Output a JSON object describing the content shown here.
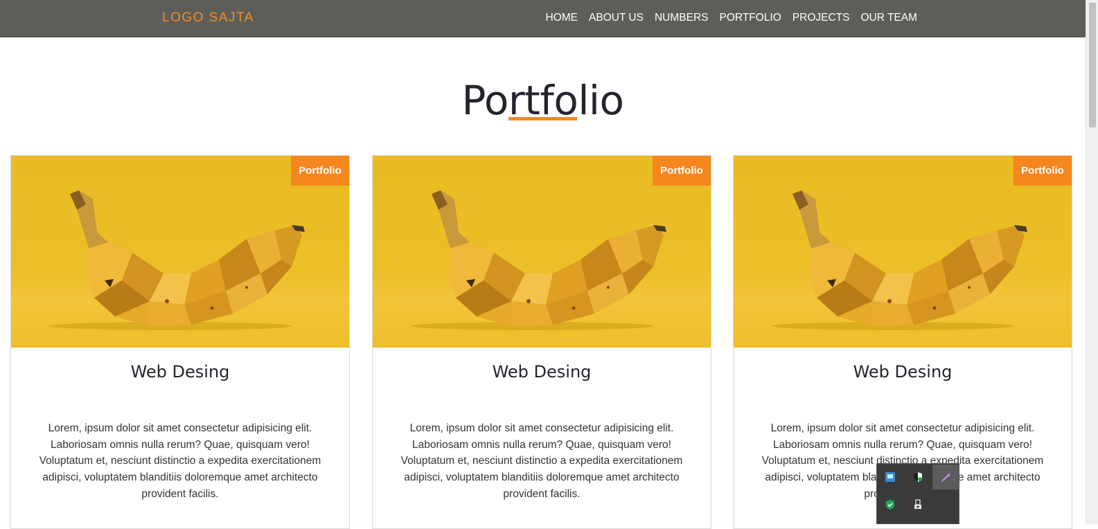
{
  "navbar": {
    "logo": "LOGO SAJTA",
    "links": [
      "HOME",
      "ABOUT US",
      "NUMBERS",
      "PORTFOLIO",
      "PROJECTS",
      "OUR TEAM"
    ]
  },
  "section": {
    "title": "Portfolio"
  },
  "cards": [
    {
      "badge": "Portfolio",
      "title": "Web Desing",
      "text": "Lorem, ipsum dolor sit amet consectetur adipisicing elit. Laboriosam omnis nulla rerum? Quae, quisquam vero! Voluptatum et, nesciunt distinctio a expedita exercitationem adipisci, voluptatem blanditiis doloremque amet architecto provident facilis."
    },
    {
      "badge": "Portfolio",
      "title": "Web Desing",
      "text": "Lorem, ipsum dolor sit amet consectetur adipisicing elit. Laboriosam omnis nulla rerum? Quae, quisquam vero! Voluptatum et, nesciunt distinctio a expedita exercitationem adipisci, voluptatem blanditiis doloremque amet architecto provident facilis."
    },
    {
      "badge": "Portfolio",
      "title": "Web Desing",
      "text": "Lorem, ipsum dolor sit amet consectetur adipisicing elit. Laboriosam omnis nulla rerum? Quae, quisquam vero! Voluptatum et, nesciunt distinctio a expedita exercitationem adipisci, voluptatem blanditiis doloremque amet architecto provident facilis."
    }
  ],
  "tray_icons": [
    "network-icon",
    "security-shield-icon",
    "pen-icon",
    "defender-check-icon",
    "usb-eject-icon"
  ],
  "colors": {
    "accent": "#f28a25",
    "navbar": "#5d5e5a",
    "card_image_bg": "#ecbf28"
  }
}
